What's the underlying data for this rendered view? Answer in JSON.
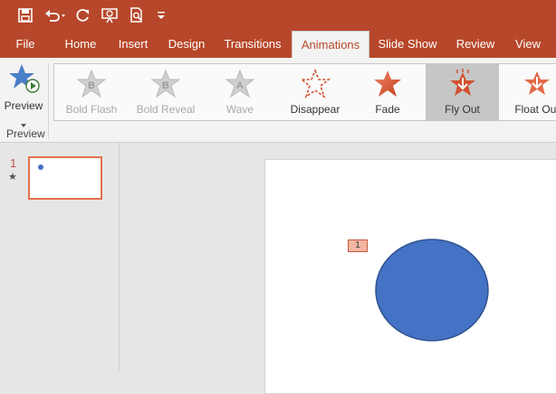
{
  "colors": {
    "accent": "#b7472a",
    "shape_fill": "#4472c4",
    "shape_stroke": "#2f528f",
    "badge_fill": "#f4b6a3"
  },
  "qat": {
    "icons": [
      "save-icon",
      "undo-icon",
      "redo-icon",
      "present-from-start-icon",
      "print-preview-icon",
      "customize-qat-icon"
    ]
  },
  "tabs": [
    "File",
    "Home",
    "Insert",
    "Design",
    "Transitions",
    "Animations",
    "Slide Show",
    "Review",
    "View"
  ],
  "active_tab": "Animations",
  "preview": {
    "button_label": "Preview",
    "group_label": "Preview"
  },
  "animations": [
    {
      "label": "Bold Flash",
      "state": "disabled",
      "glyph": "B"
    },
    {
      "label": "Bold Reveal",
      "state": "disabled",
      "glyph": "B"
    },
    {
      "label": "Wave",
      "state": "disabled",
      "glyph": "A"
    },
    {
      "label": "Disappear",
      "state": "enabled"
    },
    {
      "label": "Fade",
      "state": "enabled"
    },
    {
      "label": "Fly Out",
      "state": "selected"
    },
    {
      "label": "Float Out",
      "state": "enabled"
    }
  ],
  "thumbnails": [
    {
      "number": "1",
      "animation_marker": "★"
    }
  ],
  "slide": {
    "animation_order_badge": "1"
  }
}
